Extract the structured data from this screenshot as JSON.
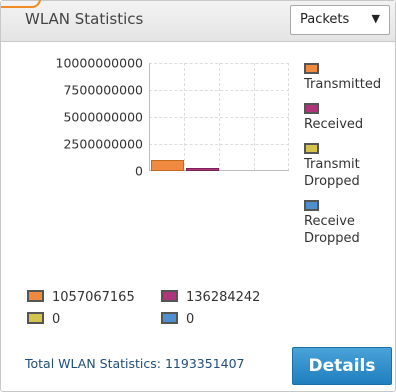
{
  "header": {
    "title": "WLAN Statistics",
    "select_value": "Packets",
    "select_arrow": "▼"
  },
  "chart_data": {
    "type": "bar",
    "categories": [
      "Transmitted",
      "Received",
      "Transmit Dropped",
      "Receive Dropped"
    ],
    "values": [
      1057067165,
      136284242,
      0,
      0
    ],
    "ylim": [
      0,
      10000000000
    ],
    "yticks": [
      "10000000000",
      "7500000000",
      "5000000000",
      "2500000000",
      "0"
    ],
    "grid": true,
    "legend_position": "right"
  },
  "legend": [
    {
      "label_lines": [
        "Transmitted"
      ],
      "color": "#f08a40"
    },
    {
      "label_lines": [
        "Received"
      ],
      "color": "#b0347a"
    },
    {
      "label_lines": [
        "Transmit",
        "Dropped"
      ],
      "color": "#d4c34e"
    },
    {
      "label_lines": [
        "Receive",
        "Dropped"
      ],
      "color": "#4e8fd0"
    }
  ],
  "stats": {
    "transmitted": "1057067165",
    "received": "136284242",
    "transmit_dropped": "0",
    "receive_dropped": "0"
  },
  "footer": {
    "total_label": "Total WLAN Statistics: 1193351407",
    "details_label": "Details"
  }
}
